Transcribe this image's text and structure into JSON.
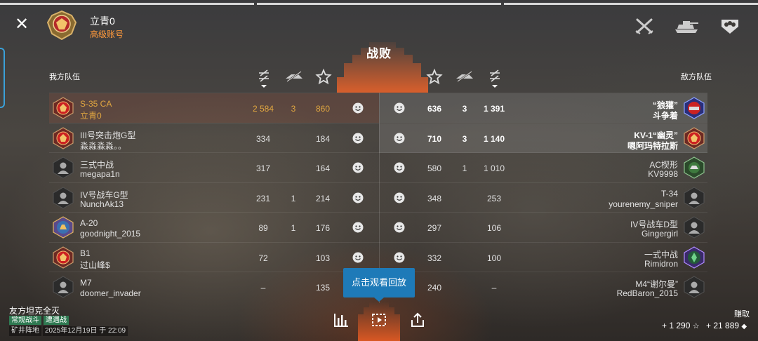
{
  "header": {
    "close_icon": "close-icon",
    "player_name": "立青0",
    "account_type": "高级账号",
    "top_icons": [
      "crossed-swords-icon",
      "tank-icon",
      "crew-icon"
    ]
  },
  "result": {
    "title": "战败",
    "ally_label": "我方队伍",
    "enemy_label": "敌方队伍",
    "columns": [
      "damage-sort-icon",
      "kills-icon",
      "star-icon"
    ]
  },
  "ally": [
    {
      "vehicle": "S-35 CA",
      "player": "立青0",
      "damage": "2 584",
      "kills": "3",
      "exp": "860",
      "self": true
    },
    {
      "vehicle": "III号突击炮G型",
      "player": "淼淼淼淼。。",
      "damage": "334",
      "kills": "",
      "exp": "184"
    },
    {
      "vehicle": "三式中战",
      "player": "megapa1n",
      "damage": "317",
      "kills": "",
      "exp": "164"
    },
    {
      "vehicle": "IV号战车G型",
      "player": "NunchAk13",
      "damage": "231",
      "kills": "1",
      "exp": "214"
    },
    {
      "vehicle": "A-20",
      "player": "goodnight_2015",
      "damage": "89",
      "kills": "1",
      "exp": "176"
    },
    {
      "vehicle": "B1",
      "player": "过山峰$",
      "damage": "72",
      "kills": "",
      "exp": "103"
    },
    {
      "vehicle": "M7",
      "player": "doomer_invader",
      "damage": "–",
      "kills": "",
      "exp": "135"
    }
  ],
  "enemy": [
    {
      "vehicle": "“狼獾”",
      "player": "斗争着",
      "exp": "636",
      "kills": "3",
      "damage": "1 391"
    },
    {
      "vehicle": "KV-1“幽灵”",
      "player": "嗯阿玛特拉斯",
      "exp": "710",
      "kills": "3",
      "damage": "1 140"
    },
    {
      "vehicle": "AC楔形",
      "player": "KV9998",
      "exp": "580",
      "kills": "1",
      "damage": "1 010"
    },
    {
      "vehicle": "T-34",
      "player": "yourenemy_sniper",
      "exp": "348",
      "kills": "",
      "damage": "253"
    },
    {
      "vehicle": "IV号战车D型",
      "player": "Gingergirl",
      "exp": "297",
      "kills": "",
      "damage": "106"
    },
    {
      "vehicle": "一式中战",
      "player": "Rimidron",
      "exp": "332",
      "kills": "",
      "damage": "100"
    },
    {
      "vehicle": "M4“谢尔曼”",
      "player": "RedBaron_2015",
      "exp": "240",
      "kills": "",
      "damage": "–"
    }
  ],
  "replay_button": "点击观看回放",
  "footer": {
    "outcome": "友方坦克全灭",
    "tags": [
      "常规战斗",
      "遭遇战"
    ],
    "map": "矿井阵地",
    "datetime": "2025年12月19日 于 22:09",
    "earn_label": "赚取",
    "earn_exp": "+ 1 290",
    "earn_credits": "+ 21 889",
    "bottom_icons": [
      "stats-icon",
      "replay-icon",
      "share-icon"
    ]
  },
  "colors": {
    "accent": "#ff9a3c",
    "replay": "#1e7ab8",
    "tag": "#2f7a52",
    "defeat_glow": "#e05a24"
  }
}
